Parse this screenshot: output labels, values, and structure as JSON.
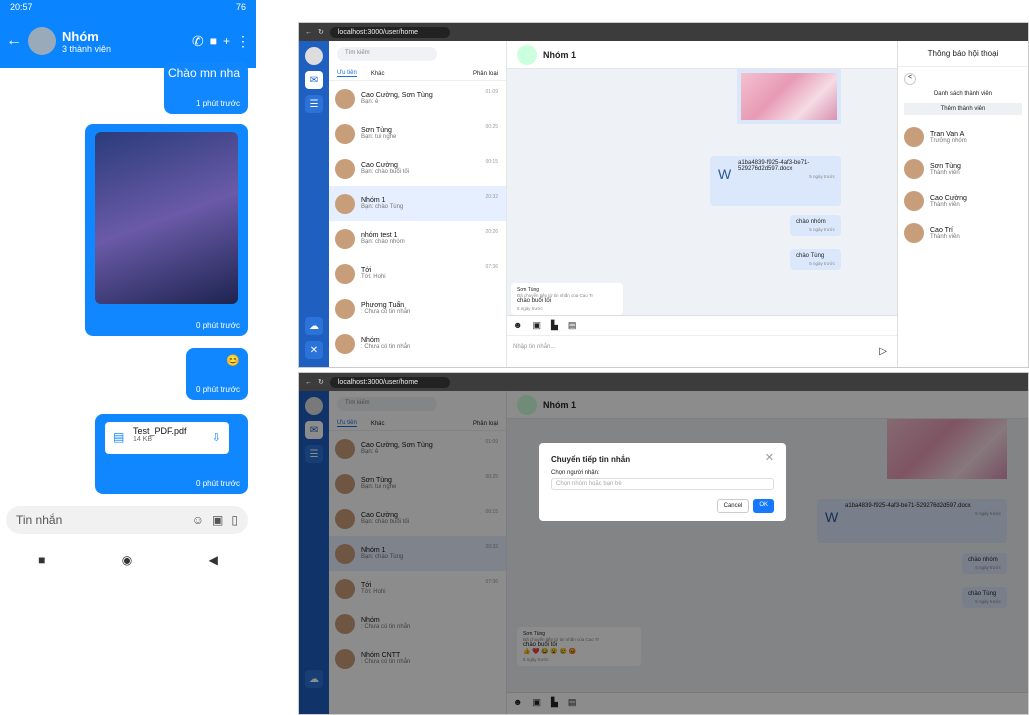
{
  "mobile": {
    "status_time": "20:57",
    "status_battery": "76",
    "title": "Nhóm",
    "subtitle": "3 thành viên",
    "top_message": "Chào mn nha",
    "time_1": "1 phút trước",
    "time_2": "0 phút trước",
    "time_3": "0 phút trước",
    "time_4": "0 phút trước",
    "emoji": "😊",
    "file_name": "Test_PDF.pdf",
    "file_size": "14 KB",
    "input_placeholder": "Tin nhắn"
  },
  "web": {
    "url": "localhost:3000/user/home",
    "search_placeholder": "Tìm kiếm",
    "tab_priority": "Ưu tiên",
    "tab_other": "Khác",
    "tab_category": "Phân loại",
    "conversations": [
      {
        "name": "Cao Cường, Sơn Tùng",
        "preview": "Bạn: ê",
        "time": "01:09"
      },
      {
        "name": "Sơn Tùng",
        "preview": "Bạn: tui nghe",
        "time": "00:25"
      },
      {
        "name": "Cao Cường",
        "preview": "Bạn: chào buổi tối",
        "time": "00:15"
      },
      {
        "name": "Nhóm 1",
        "preview": "Bạn: chào Tùng",
        "time": "20:32"
      },
      {
        "name": "nhóm test 1",
        "preview": "Bạn: chào nhóm",
        "time": "20:26"
      },
      {
        "name": "Tới",
        "preview": "Tới: Hohi",
        "time": "07:36"
      },
      {
        "name": "Phương Tuấn",
        "preview": ": Chưa có tin nhắn",
        "time": ""
      },
      {
        "name": "Nhóm",
        "preview": ": Chưa có tin nhắn",
        "time": ""
      }
    ],
    "conversations2": [
      {
        "name": "Cao Cường, Sơn Tùng",
        "preview": "Bạn: ê",
        "time": "01:09"
      },
      {
        "name": "Sơn Tùng",
        "preview": "Bạn: tui nghe",
        "time": "00:25"
      },
      {
        "name": "Cao Cường",
        "preview": "Bạn: chào buổi tối",
        "time": "00:15"
      },
      {
        "name": "Nhóm 1",
        "preview": "Bạn: chào Tùng",
        "time": "20:32"
      },
      {
        "name": "Tới",
        "preview": "Tới: Hohi",
        "time": "07:36"
      },
      {
        "name": "Nhóm",
        "preview": ": Chưa có tin nhắn",
        "time": ""
      },
      {
        "name": "Nhóm CNTT",
        "preview": ": Chưa có tin nhắn",
        "time": ""
      }
    ],
    "chat_title": "Nhóm 1",
    "file_msg": "a1ba4839-f925-4af3-be71-529276d2d597.docx",
    "ago": "5 ngày trước",
    "msg_hello_group": "chào nhóm",
    "msg_hello_tung": "chào Tùng",
    "fwd_sender": "Sơn Tùng",
    "fwd_note": "Đã chuyển tiếp từ tin nhắn của Cao Tr",
    "fwd_text": "chào buổi tối",
    "input_placeholder": "Nhập tin nhắn...",
    "info_title": "Thông báo hội thoại",
    "members_title": "Danh sách thành viên",
    "add_member": "Thêm thành viên",
    "members": [
      {
        "name": "Tran Van A",
        "role": "Trưởng nhóm"
      },
      {
        "name": "Sơn Tùng",
        "role": "Thành viên"
      },
      {
        "name": "Cao Cường",
        "role": "Thành viên"
      },
      {
        "name": "Cao Trí",
        "role": "Thành viên"
      }
    ],
    "modal_title": "Chuyển tiếp tin nhắn",
    "modal_label": "Chọn người nhận:",
    "modal_placeholder": "Chọn nhóm hoặc bạn bè",
    "cancel": "Cancel",
    "ok": "OK",
    "reactions": "👍 ❤️ 😂 😮 😢 😡"
  },
  "colors": {
    "accent": "#1187ff",
    "rail": "#1e5fbf"
  }
}
